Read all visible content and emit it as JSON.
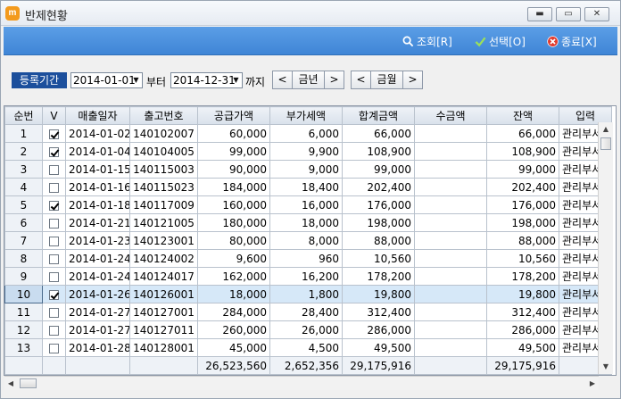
{
  "window": {
    "title": "반제현황",
    "app_icon_glyph": "m",
    "minimize_glyph": "▬",
    "maximize_glyph": "▭",
    "close_glyph": "✕"
  },
  "toolbar": {
    "search_label": "조회[R]",
    "select_label": "선택[O]",
    "close_label": "종료[X]"
  },
  "filter": {
    "period_label": "등록기간",
    "date_from": "2014-01-01",
    "from_label": "부터",
    "date_to": "2014-12-31",
    "to_label": "까지",
    "prev_glyph": "<",
    "next_glyph": ">",
    "year_label": "금년",
    "month_label": "금월"
  },
  "grid": {
    "columns": [
      "순번",
      "V",
      "매출일자",
      "출고번호",
      "공급가액",
      "부가세액",
      "합계금액",
      "수금액",
      "잔액",
      "입력"
    ],
    "rows": [
      {
        "seq": "1",
        "checked": true,
        "date": "2014-01-02",
        "no": "140102007",
        "supply": "60,000",
        "vat": "6,000",
        "total": "66,000",
        "received": "",
        "balance": "66,000",
        "input": "관리부서"
      },
      {
        "seq": "2",
        "checked": true,
        "date": "2014-01-04",
        "no": "140104005",
        "supply": "99,000",
        "vat": "9,900",
        "total": "108,900",
        "received": "",
        "balance": "108,900",
        "input": "관리부서"
      },
      {
        "seq": "3",
        "checked": false,
        "date": "2014-01-15",
        "no": "140115003",
        "supply": "90,000",
        "vat": "9,000",
        "total": "99,000",
        "received": "",
        "balance": "99,000",
        "input": "관리부서"
      },
      {
        "seq": "4",
        "checked": false,
        "date": "2014-01-16",
        "no": "140115023",
        "supply": "184,000",
        "vat": "18,400",
        "total": "202,400",
        "received": "",
        "balance": "202,400",
        "input": "관리부서"
      },
      {
        "seq": "5",
        "checked": true,
        "date": "2014-01-18",
        "no": "140117009",
        "supply": "160,000",
        "vat": "16,000",
        "total": "176,000",
        "received": "",
        "balance": "176,000",
        "input": "관리부서"
      },
      {
        "seq": "6",
        "checked": false,
        "date": "2014-01-21",
        "no": "140121005",
        "supply": "180,000",
        "vat": "18,000",
        "total": "198,000",
        "received": "",
        "balance": "198,000",
        "input": "관리부서"
      },
      {
        "seq": "7",
        "checked": false,
        "date": "2014-01-23",
        "no": "140123001",
        "supply": "80,000",
        "vat": "8,000",
        "total": "88,000",
        "received": "",
        "balance": "88,000",
        "input": "관리부서"
      },
      {
        "seq": "8",
        "checked": false,
        "date": "2014-01-24",
        "no": "140124002",
        "supply": "9,600",
        "vat": "960",
        "total": "10,560",
        "received": "",
        "balance": "10,560",
        "input": "관리부서"
      },
      {
        "seq": "9",
        "checked": false,
        "date": "2014-01-24",
        "no": "140124017",
        "supply": "162,000",
        "vat": "16,200",
        "total": "178,200",
        "received": "",
        "balance": "178,200",
        "input": "관리부서"
      },
      {
        "seq": "10",
        "checked": true,
        "date": "2014-01-26",
        "no": "140126001",
        "supply": "18,000",
        "vat": "1,800",
        "total": "19,800",
        "received": "",
        "balance": "19,800",
        "input": "관리부서",
        "selected": true
      },
      {
        "seq": "11",
        "checked": false,
        "date": "2014-01-27",
        "no": "140127001",
        "supply": "284,000",
        "vat": "28,400",
        "total": "312,400",
        "received": "",
        "balance": "312,400",
        "input": "관리부서"
      },
      {
        "seq": "12",
        "checked": false,
        "date": "2014-01-27",
        "no": "140127011",
        "supply": "260,000",
        "vat": "26,000",
        "total": "286,000",
        "received": "",
        "balance": "286,000",
        "input": "관리부서"
      },
      {
        "seq": "13",
        "checked": false,
        "date": "2014-01-28",
        "no": "140128001",
        "supply": "45,000",
        "vat": "4,500",
        "total": "49,500",
        "received": "",
        "balance": "49,500",
        "input": "관리부서"
      }
    ],
    "totals": {
      "supply": "26,523,560",
      "vat": "2,652,356",
      "total": "29,175,916",
      "received": "",
      "balance": "29,175,916"
    }
  },
  "scroll": {
    "up_glyph": "▲",
    "down_glyph": "▼",
    "left_glyph": "◀",
    "right_glyph": "▶"
  },
  "colors": {
    "toolbar": "#4a90dd",
    "period_label_bg": "#1c4f9c",
    "selected_row": "#d6e8f8"
  },
  "icons": {
    "search": "magnifier-icon",
    "select": "checkmark-icon",
    "close": "close-circle-icon"
  }
}
